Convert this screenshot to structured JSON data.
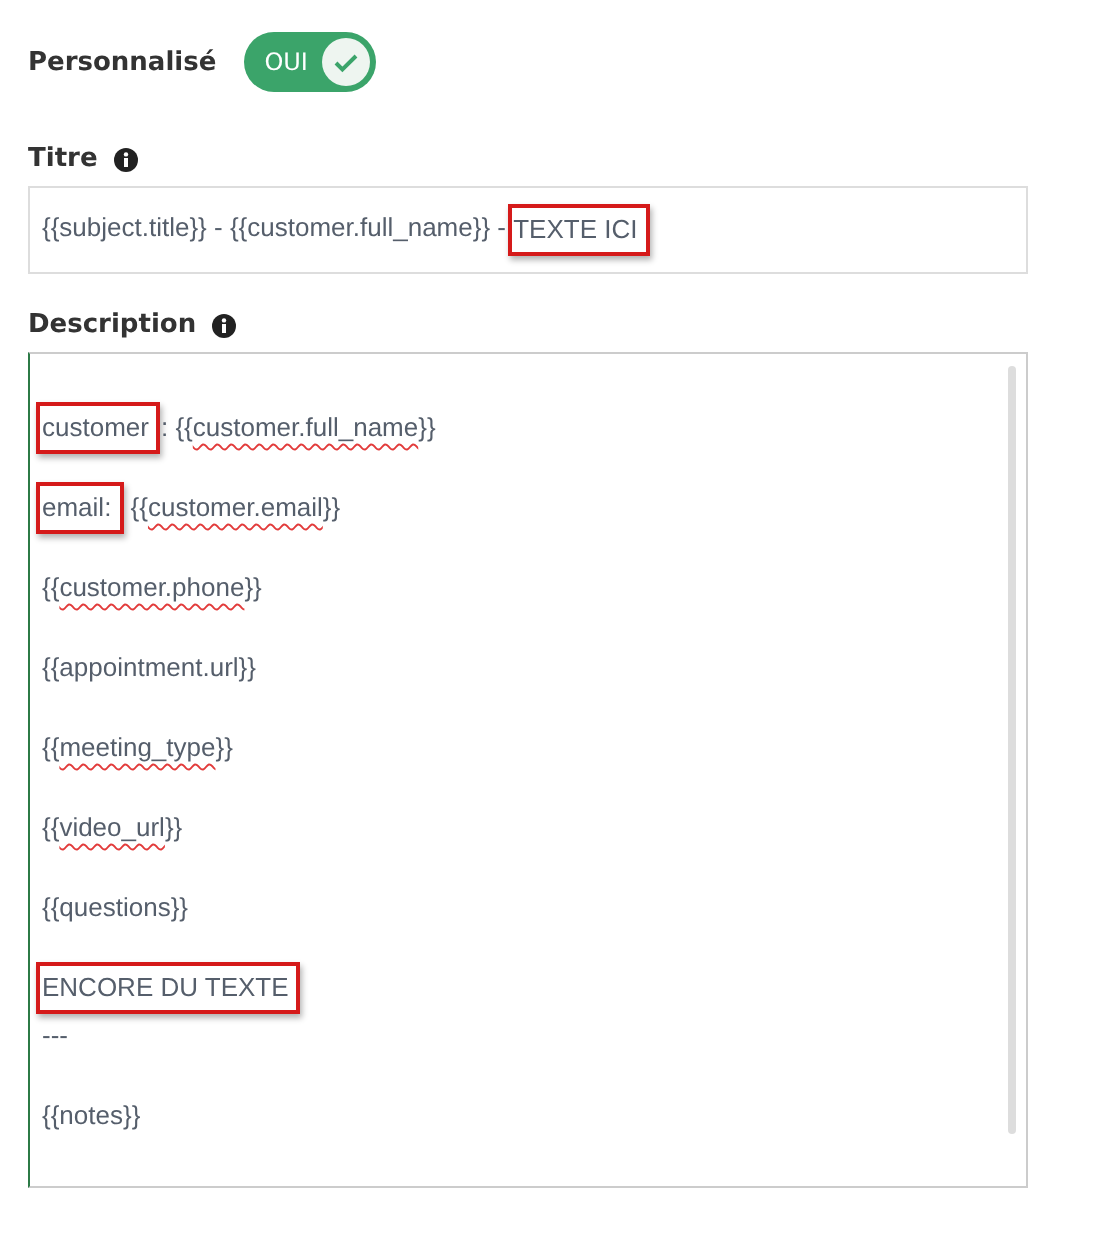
{
  "custom": {
    "label": "Personnalisé",
    "toggle": {
      "label": "OUI",
      "on": true
    }
  },
  "title_field": {
    "label": "Titre",
    "segments": [
      {
        "text": "{{subject.title}} - {{customer.full_name}} - ",
        "highlighted": false,
        "misspelled": false
      },
      {
        "text": "TEXTE ICI",
        "highlighted": true,
        "misspelled": false
      }
    ]
  },
  "description": {
    "label": "Description",
    "paragraphs": [
      {
        "lines": [
          [
            {
              "text": "customer",
              "highlighted": true,
              "misspelled": false
            },
            {
              "text": ": {{",
              "highlighted": false,
              "misspelled": false
            },
            {
              "text": "customer.full_name",
              "highlighted": false,
              "misspelled": true
            },
            {
              "text": "}}",
              "highlighted": false,
              "misspelled": false
            }
          ]
        ]
      },
      {
        "lines": [
          [
            {
              "text": "email:",
              "highlighted": true,
              "misspelled": false
            },
            {
              "text": " {{",
              "highlighted": false,
              "misspelled": false
            },
            {
              "text": "customer.email",
              "highlighted": false,
              "misspelled": true
            },
            {
              "text": "}}",
              "highlighted": false,
              "misspelled": false
            }
          ]
        ]
      },
      {
        "lines": [
          [
            {
              "text": "{{",
              "highlighted": false,
              "misspelled": false
            },
            {
              "text": "customer.phone",
              "highlighted": false,
              "misspelled": true
            },
            {
              "text": "}}",
              "highlighted": false,
              "misspelled": false
            }
          ]
        ]
      },
      {
        "lines": [
          [
            {
              "text": "{{appointment.url}}",
              "highlighted": false,
              "misspelled": false
            }
          ]
        ]
      },
      {
        "lines": [
          [
            {
              "text": "{{",
              "highlighted": false,
              "misspelled": false
            },
            {
              "text": "meeting_type",
              "highlighted": false,
              "misspelled": true
            },
            {
              "text": "}}",
              "highlighted": false,
              "misspelled": false
            }
          ]
        ]
      },
      {
        "lines": [
          [
            {
              "text": "{{",
              "highlighted": false,
              "misspelled": false
            },
            {
              "text": "video_url",
              "highlighted": false,
              "misspelled": true
            },
            {
              "text": "}}",
              "highlighted": false,
              "misspelled": false
            }
          ]
        ]
      },
      {
        "lines": [
          [
            {
              "text": "{{questions}}",
              "highlighted": false,
              "misspelled": false
            }
          ]
        ]
      },
      {
        "lines": [
          [
            {
              "text": "ENCORE DU TEXTE",
              "highlighted": true,
              "misspelled": false
            }
          ],
          [
            {
              "text": "---",
              "highlighted": false,
              "misspelled": false
            }
          ]
        ]
      },
      {
        "lines": [
          [
            {
              "text": "{{notes}}",
              "highlighted": false,
              "misspelled": false
            }
          ]
        ]
      }
    ]
  }
}
